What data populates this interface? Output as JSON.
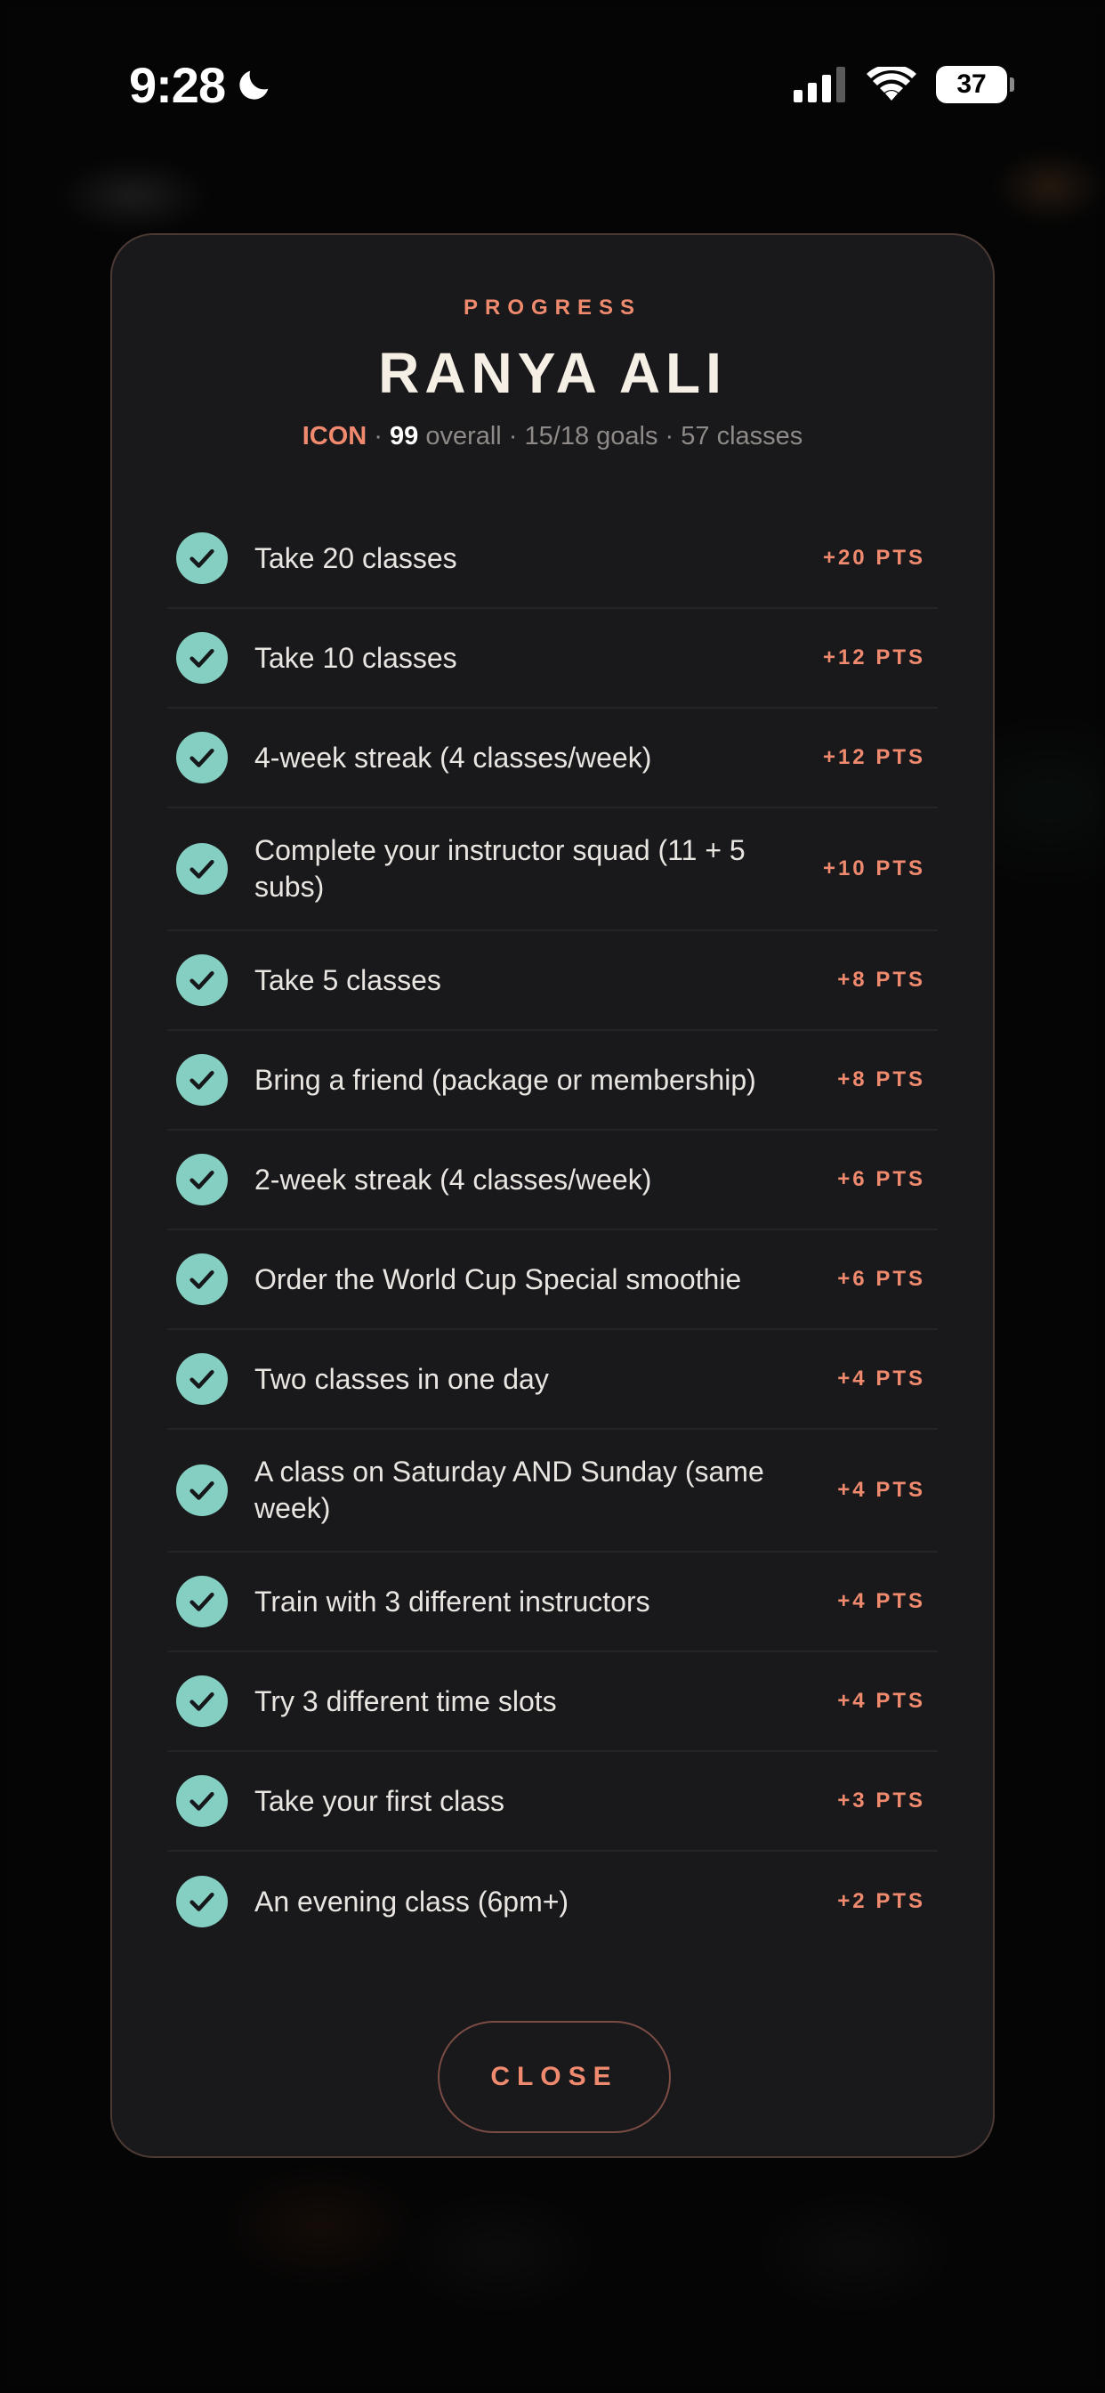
{
  "status_bar": {
    "time": "9:28",
    "battery": "37"
  },
  "modal": {
    "eyebrow": "PROGRESS",
    "title": "RANYA ALI",
    "summary": {
      "tier": "ICON",
      "sep1": " · ",
      "score": "99",
      "rest": " overall · 15/18 goals · 57 classes"
    },
    "goals": [
      {
        "label": "Take 20 classes",
        "points": "+20 PTS"
      },
      {
        "label": "Take 10 classes",
        "points": "+12 PTS"
      },
      {
        "label": "4-week streak (4 classes/week)",
        "points": "+12 PTS"
      },
      {
        "label": "Complete your instructor squad (11 + 5 subs)",
        "points": "+10 PTS"
      },
      {
        "label": "Take 5 classes",
        "points": "+8 PTS"
      },
      {
        "label": "Bring a friend (package or membership)",
        "points": "+8 PTS"
      },
      {
        "label": "2-week streak (4 classes/week)",
        "points": "+6 PTS"
      },
      {
        "label": "Order the World Cup Special smoothie",
        "points": "+6 PTS"
      },
      {
        "label": "Two classes in one day",
        "points": "+4 PTS"
      },
      {
        "label": "A class on Saturday AND Sunday (same week)",
        "points": "+4 PTS"
      },
      {
        "label": "Train with 3 different instructors",
        "points": "+4 PTS"
      },
      {
        "label": "Try 3 different time slots",
        "points": "+4 PTS"
      },
      {
        "label": "Take your first class",
        "points": "+3 PTS"
      },
      {
        "label": "An evening class (6pm+)",
        "points": "+2 PTS"
      }
    ],
    "close_label": "CLOSE"
  },
  "colors": {
    "accent": "#f08a6e",
    "check": "#84cfc2",
    "card": "#19181b"
  },
  "icons": {
    "moon": "moon-icon",
    "cellular": "cellular-signal-icon",
    "wifi": "wifi-icon",
    "battery": "battery-icon",
    "check": "checkmark-circle-icon"
  }
}
